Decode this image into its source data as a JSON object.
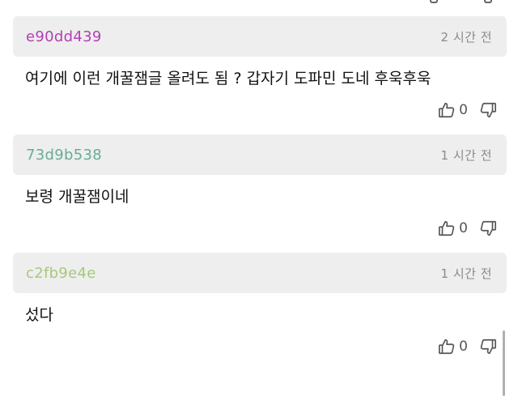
{
  "colors": {
    "header_bg": "#eeeeee",
    "timestamp": "#8a8a8a",
    "body_text": "#111111",
    "vote_icon": "#555555"
  },
  "comments": [
    {
      "author": "e90dd439",
      "author_color": "#b43fb4",
      "time": "2 시간 전",
      "text": "여기에 이런 개꿀잼글 올려도 됨 ? 갑자기 도파민 도네 후욱후욱",
      "likes": "0",
      "like_icon": "thumbs-up-icon",
      "dislike_icon": "thumbs-down-icon"
    },
    {
      "author": "73d9b538",
      "author_color": "#6bab96",
      "time": "1 시간 전",
      "text": "보령 개꿀잼이네",
      "likes": "0",
      "like_icon": "thumbs-up-icon",
      "dislike_icon": "thumbs-down-icon"
    },
    {
      "author": "c2fb9e4e",
      "author_color": "#a6c97a",
      "time": "1 시간 전",
      "text": "섰다",
      "likes": "0",
      "like_icon": "thumbs-up-icon",
      "dislike_icon": "thumbs-down-icon"
    }
  ]
}
